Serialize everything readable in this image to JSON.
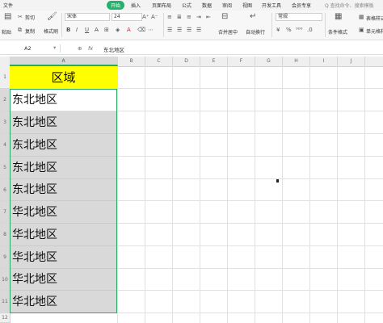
{
  "menu": {
    "file": "文件",
    "tabs": [
      "开始",
      "插入",
      "页面布局",
      "公式",
      "数据",
      "审阅",
      "视图",
      "开发工具",
      "会员专享"
    ],
    "active_tab": "开始",
    "search": "Q 查找命令、搜索模板"
  },
  "ribbon": {
    "cut": "剪切",
    "copy": "复制",
    "format_painter": "格式刷",
    "paste": "粘贴",
    "font_name": "宋体",
    "font_size": "24",
    "merge_center": "合并居中",
    "wrap_text": "自动换行",
    "number_format": "常规",
    "conditional_format": "条件格式",
    "table_style": "表格样式",
    "cell_style": "单元格样式"
  },
  "formula_bar": {
    "name_box": "A2",
    "fx": "fx",
    "value": "东北地区"
  },
  "columns": [
    "A",
    "B",
    "C",
    "D",
    "E",
    "F",
    "G",
    "H",
    "I",
    "J"
  ],
  "rows": [
    "1",
    "2",
    "3",
    "4",
    "5",
    "6",
    "7",
    "8",
    "9",
    "10",
    "11",
    "12"
  ],
  "cells": {
    "header": "区域",
    "values": [
      "东北地区",
      "东北地区",
      "东北地区",
      "东北地区",
      "东北地区",
      "华北地区",
      "华北地区",
      "华北地区",
      "华北地区",
      "华北地区"
    ]
  },
  "colors": {
    "accent": "#23b26b",
    "header_fill": "#ffff00",
    "selection_fill": "#d9d9d9",
    "selection_border": "#2aa866"
  }
}
